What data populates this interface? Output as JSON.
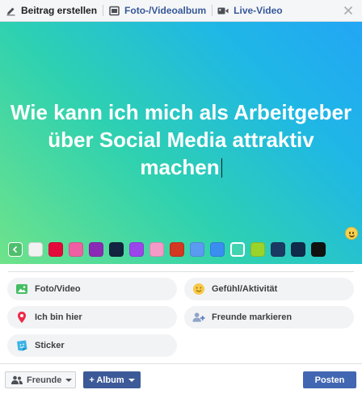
{
  "tabs": [
    {
      "label": "Beitrag erstellen",
      "icon": "pencil-icon"
    },
    {
      "label": "Foto-/Videoalbum",
      "icon": "photo-album-icon"
    },
    {
      "label": "Live-Video",
      "icon": "video-camera-icon"
    }
  ],
  "post": {
    "text": "Wie kann ich mich als Arbeitgeber über Social Media attraktiv machen",
    "background_gradient": [
      "#6fe38a",
      "#23a6f5"
    ]
  },
  "backgrounds": [
    {
      "name": "white",
      "color": "#f2f2f2"
    },
    {
      "name": "red",
      "color": "#e4093a"
    },
    {
      "name": "pink-pattern",
      "color": "#f05fa4"
    },
    {
      "name": "purple-pink",
      "color": "#8b2bb5"
    },
    {
      "name": "dark-navy",
      "color": "#12243f"
    },
    {
      "name": "purple",
      "color": "#9b46ea"
    },
    {
      "name": "pink-dots",
      "color": "#f49ac9"
    },
    {
      "name": "red-pattern",
      "color": "#d23822"
    },
    {
      "name": "blue-pattern",
      "color": "#5a9bf1"
    },
    {
      "name": "blue",
      "color": "#3a8ef0"
    },
    {
      "name": "teal-selected",
      "color": "#40d4b0"
    },
    {
      "name": "yellow-green",
      "color": "#9ad42b"
    },
    {
      "name": "navy-drips",
      "color": "#1b3a63"
    },
    {
      "name": "navy-wave",
      "color": "#0f2a4a"
    },
    {
      "name": "black",
      "color": "#111111"
    }
  ],
  "options": [
    {
      "label": "Foto/Video",
      "icon": "photo-icon"
    },
    {
      "label": "Gefühl/Aktivität",
      "icon": "smiley-icon"
    },
    {
      "label": "Ich bin hier",
      "icon": "location-pin-icon"
    },
    {
      "label": "Freunde markieren",
      "icon": "tag-friends-icon"
    },
    {
      "label": "Sticker",
      "icon": "sticker-icon"
    }
  ],
  "footer": {
    "audience_label": "Freunde",
    "album_label": "+ Album",
    "post_label": "Posten"
  },
  "colors": {
    "accent": "#4267b2",
    "link": "#365899",
    "album": "#3d5a98"
  }
}
